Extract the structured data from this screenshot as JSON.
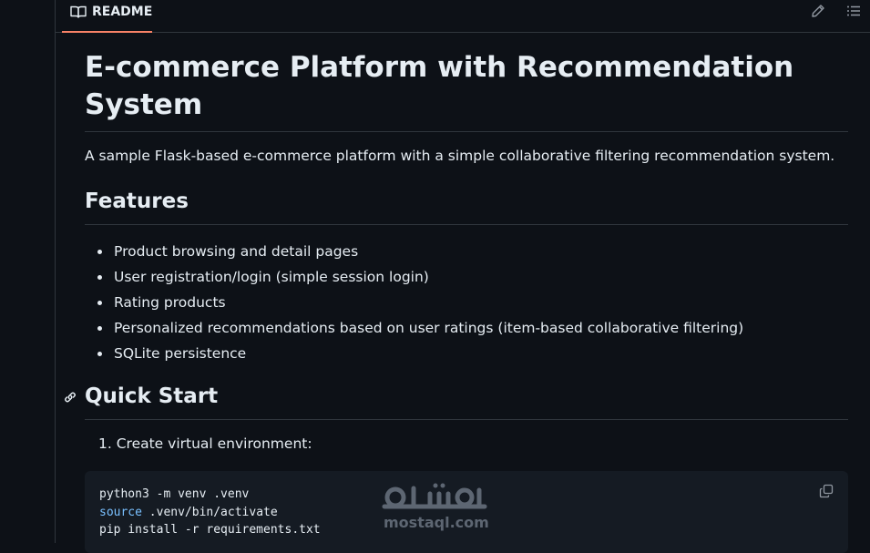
{
  "tabbar": {
    "readme_label": "README",
    "icons": {
      "tab": "book-icon",
      "edit": "pencil-icon",
      "outline": "list-icon"
    }
  },
  "readme": {
    "title": "E-commerce Platform with Recommendation System",
    "intro": "A sample Flask-based e-commerce platform with a simple collaborative filtering recommendation system.",
    "features_heading": "Features",
    "features": [
      "Product browsing and detail pages",
      "User registration/login (simple session login)",
      "Rating products",
      "Personalized recommendations based on user ratings (item-based collaborative filtering)",
      "SQLite persistence"
    ],
    "quickstart_heading": "Quick Start",
    "steps": [
      "1. Create virtual environment:"
    ],
    "code": {
      "line1": "python3 -m venv .venv",
      "line2_keyword": "source",
      "line2_rest": " .venv/bin/activate",
      "line3": "pip install -r requirements.txt"
    }
  },
  "watermark": {
    "arabic": "مستقل",
    "latin": "mostaql.com"
  },
  "colors": {
    "background": "#0d1117",
    "border": "#30363d",
    "text": "#e6edf3",
    "tab_underline": "#f78166",
    "code_background": "#151b23",
    "code_keyword": "#79c0ff"
  }
}
